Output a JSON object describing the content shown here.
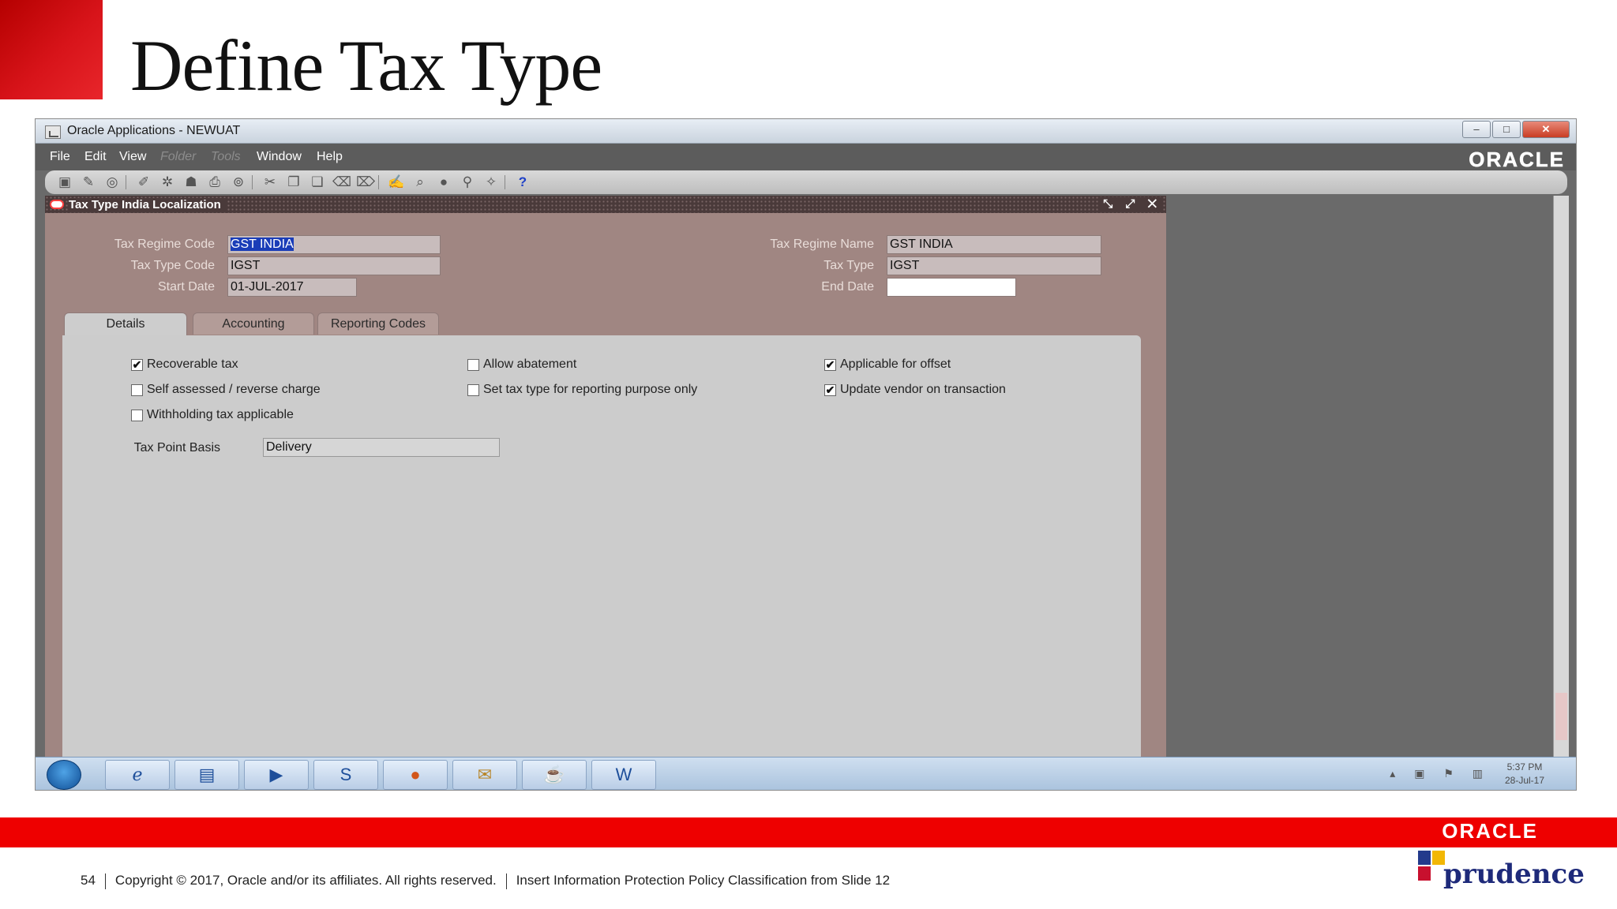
{
  "slide": {
    "title": "Define Tax Type"
  },
  "window": {
    "title": "Oracle Applications - NEWUAT",
    "controls": {
      "minimize": "–",
      "maximize": "□",
      "close": "✕"
    }
  },
  "menu": {
    "items": [
      "File",
      "Edit",
      "View",
      "Folder",
      "Tools",
      "Window",
      "Help"
    ],
    "brand": "ORACLE"
  },
  "form": {
    "title": "Tax Type India Localization",
    "title_controls": "⤡ ⤢ ✕",
    "tax_regime_code_label": "Tax Regime Code",
    "tax_regime_code": "GST INDIA",
    "tax_type_code_label": "Tax Type Code",
    "tax_type_code": "IGST",
    "start_date_label": "Start Date",
    "start_date": "01-JUL-2017",
    "tax_regime_name_label": "Tax Regime Name",
    "tax_regime_name": "GST INDIA",
    "tax_type_label": "Tax Type",
    "tax_type": "IGST",
    "end_date_label": "End Date",
    "end_date": ""
  },
  "tabs": [
    "Details",
    "Accounting",
    "Reporting Codes"
  ],
  "details": {
    "checkboxes": [
      {
        "label": "Recoverable tax",
        "checked": true
      },
      {
        "label": "Self assessed / reverse charge",
        "checked": false
      },
      {
        "label": "Withholding tax applicable",
        "checked": false
      },
      {
        "label": "Allow abatement",
        "checked": false
      },
      {
        "label": "Set tax type for reporting purpose only",
        "checked": false
      },
      {
        "label": "Applicable for offset",
        "checked": true
      },
      {
        "label": "Update vendor on transaction",
        "checked": true
      }
    ],
    "tax_point_basis_label": "Tax Point Basis",
    "tax_point_basis": "Delivery"
  },
  "taskbar": {
    "clock_time": "5:37 PM",
    "clock_date": "28-Jul-17"
  },
  "footer": {
    "page_number": "54",
    "copyright": "Copyright © 2017, Oracle and/or its affiliates. All rights reserved.",
    "classification": "Insert Information Protection Policy Classification from Slide 12",
    "oracle_logo": "ORACLE",
    "partner_logo": "prudence"
  },
  "colors": {
    "accent_red": "#ee0000",
    "form_background": "#a08682",
    "selection_blue": "#1a3db8"
  }
}
